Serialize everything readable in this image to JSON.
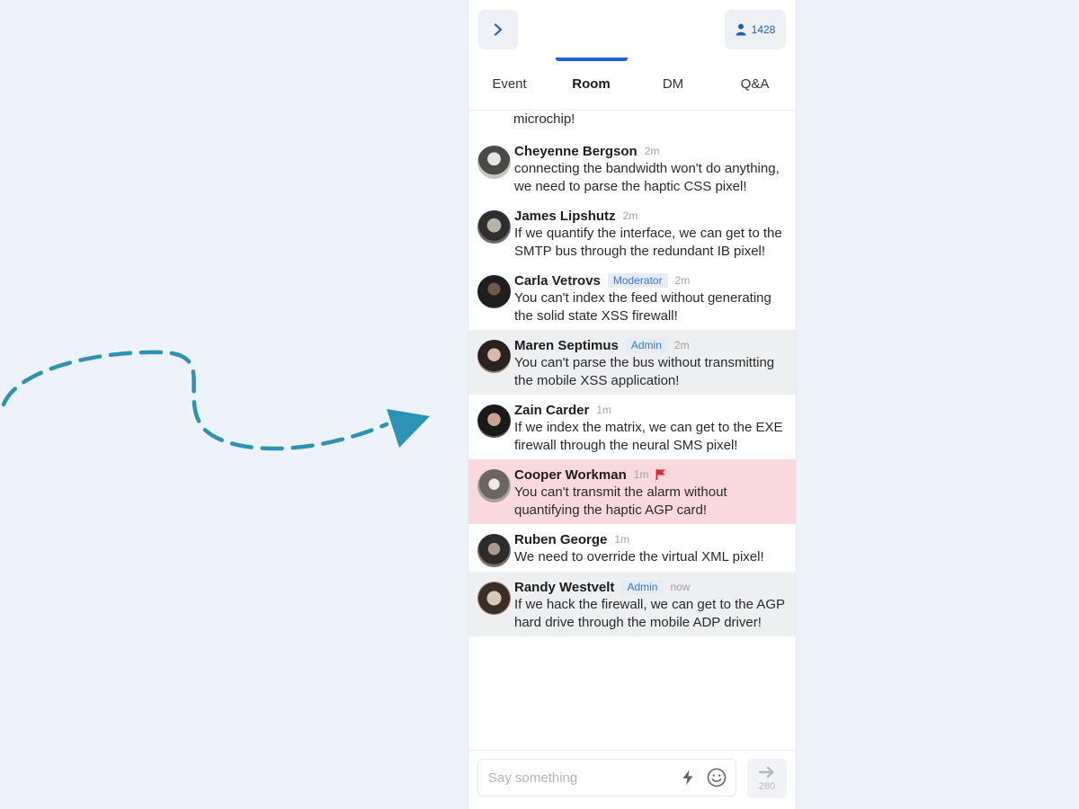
{
  "topbar": {
    "collapse_icon": "chevron-right-icon",
    "attendee_icon": "person-icon",
    "attendee_count": "1428"
  },
  "tabs": [
    {
      "label": "Event",
      "active": false
    },
    {
      "label": "Room",
      "active": true
    },
    {
      "label": "DM",
      "active": false
    },
    {
      "label": "Q&A",
      "active": false
    }
  ],
  "messages": {
    "partial_top": "microchip!",
    "items": [
      {
        "author": "Cheyenne Bergson",
        "time": "2m",
        "badge": "",
        "text": "connecting the bandwidth won't do anything, we need to parse the haptic CSS pixel!"
      },
      {
        "author": "James Lipshutz",
        "time": "2m",
        "badge": "",
        "text": "If we quantify the interface, we can get to the SMTP bus through the redundant IB pixel!"
      },
      {
        "author": "Carla Vetrovs",
        "time": "2m",
        "badge": "Moderator",
        "text": "You can't index the feed without generating the solid state XSS firewall!"
      },
      {
        "author": "Maren Septimus",
        "time": "2m",
        "badge": "Admin",
        "text": "You can't parse the bus without transmitting the mobile XSS application!"
      },
      {
        "author": "Zain Carder",
        "time": "1m",
        "badge": "",
        "text": "If we index the matrix, we can get to the EXE firewall through the neural SMS pixel!"
      },
      {
        "author": "Cooper Workman",
        "time": "1m",
        "badge": "",
        "text": "You can't transmit the alarm without quantifying the haptic AGP card!"
      },
      {
        "author": "Ruben George",
        "time": "1m",
        "badge": "",
        "text": "We need to override the virtual XML pixel!"
      },
      {
        "author": "Randy Westvelt",
        "time": "now",
        "badge": "Admin",
        "text": "If we hack the firewall, we can get to the AGP hard drive through the mobile ADP driver!"
      }
    ]
  },
  "composer": {
    "placeholder": "Say something",
    "char_limit": "280",
    "lightning_icon": "lightning-icon",
    "emoji_icon": "smiley-icon",
    "send_icon": "arrow-right-icon"
  },
  "colors": {
    "accent": "#1e63d0",
    "arrow_decoration": "#2c93b5",
    "flagged_background": "#f9d9dd",
    "highlight_background": "#eeeff1",
    "flag": "#e0282f"
  }
}
